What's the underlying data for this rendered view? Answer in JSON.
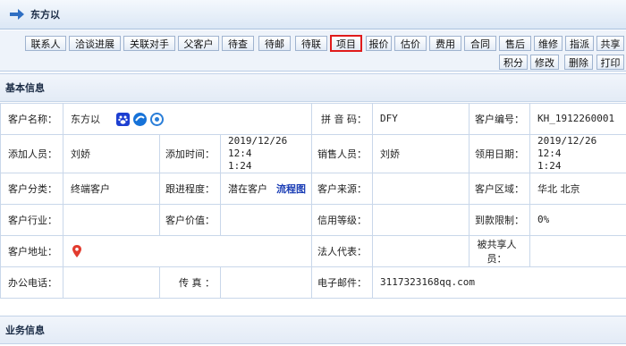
{
  "header": {
    "title": "东方以"
  },
  "toolbar": {
    "row1": [
      "联系人",
      "洽谈进展",
      "关联对手",
      "父客户",
      "待查",
      "待邮",
      "待联",
      "项目",
      "报价",
      "估价",
      "费用",
      "合同",
      "售后",
      "维修",
      "指派",
      "共享"
    ],
    "row2": [
      "积分",
      "修改",
      "删除",
      "打印"
    ],
    "highlighted": "项目",
    "highlight_color": "#e01b1b"
  },
  "sections": {
    "basic": "基本信息",
    "business": "业务信息"
  },
  "fields": {
    "name_label": "客户名称：",
    "name_value": "东方以",
    "pinyin_label": "拼 音 码：",
    "pinyin_value": "DFY",
    "code_label": "客户编号：",
    "code_value": "KH_1912260001",
    "adder_label": "添加人员：",
    "adder_value": "刘娇",
    "addtime_label": "添加时间：",
    "addtime_value": "2019/12/26 12:4\n1:24",
    "sales_label": "销售人员：",
    "sales_value": "刘娇",
    "claim_label": "领用日期：",
    "claim_value": "2019/12/26 12:4\n1:24",
    "category_label": "客户分类：",
    "category_value": "终端客户",
    "followup_label": "跟进程度：",
    "followup_value": "潜在客户",
    "flow_link": "流程图",
    "source_label": "客户来源：",
    "source_value": "",
    "region_label": "客户区域：",
    "region_value": "华北 北京",
    "industry_label": "客户行业：",
    "industry_value": "",
    "worth_label": "客户价值：",
    "worth_value": "",
    "credit_label": "信用等级：",
    "credit_value": "",
    "limit_label": "到款限制：",
    "limit_value": "0%",
    "address_label": "客户地址：",
    "address_value": "",
    "legal_label": "法人代表：",
    "legal_value": "",
    "shared_label": "被共享人\n员：",
    "shared_value": "",
    "phone_label": "办公电话：",
    "phone_value": "",
    "fax_label": "传 真 ：",
    "fax_value": "",
    "email_label": "电子邮件：",
    "email_value": "3117323168qq.com"
  },
  "icons": [
    "baidu-icon",
    "browser-icon",
    "search-engine-icon",
    "map-pin-icon"
  ]
}
